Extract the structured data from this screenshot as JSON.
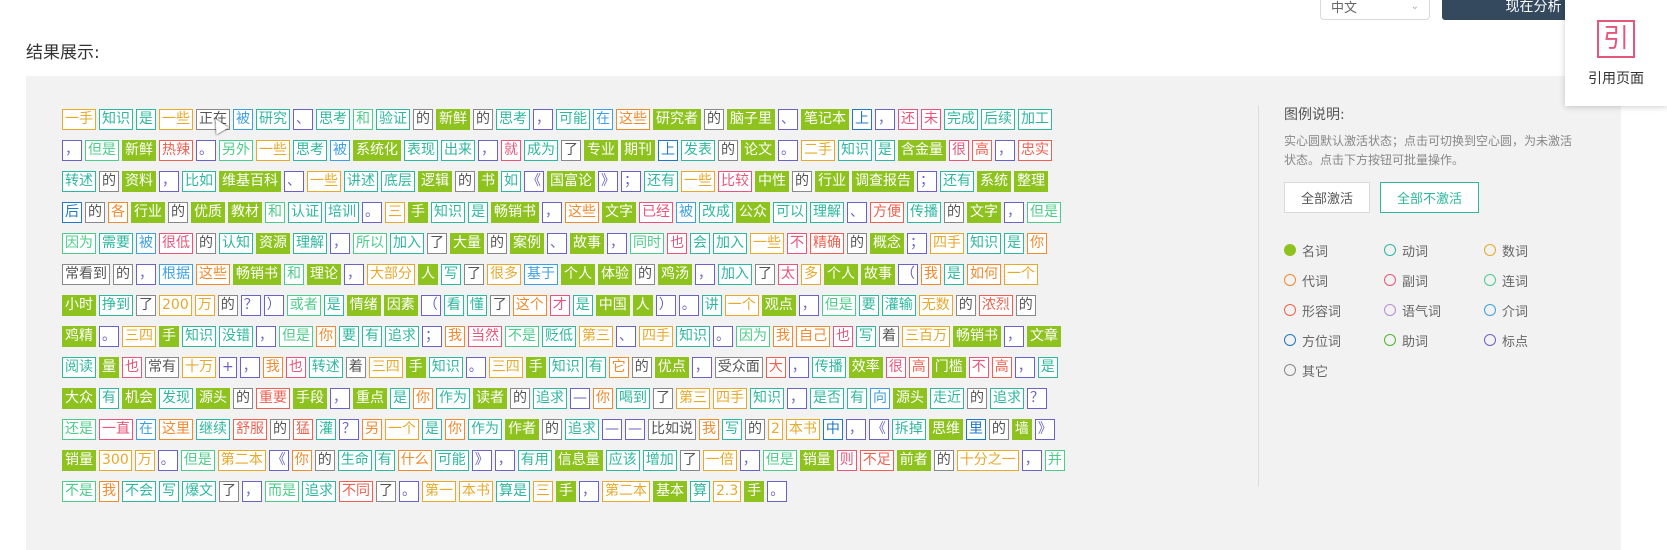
{
  "top_select": {
    "value": "中文"
  },
  "top_button": {
    "label": "现在分析"
  },
  "section_title": "结果展示:",
  "cite": {
    "icon": "引",
    "label": "引用页面"
  },
  "legend": {
    "title": "图例说明:",
    "desc": "实心圆默认激活状态；点击可切换到空心圆，为未激活状态。点击下方按钮可批量操作。",
    "btn_all_on": "全部激活",
    "btn_all_off": "全部不激活",
    "items": [
      {
        "label": "名词",
        "color": "#8ec31f",
        "filled": true
      },
      {
        "label": "动词",
        "color": "#2db7a0",
        "filled": false
      },
      {
        "label": "数词",
        "color": "#e8a92a",
        "filled": false
      },
      {
        "label": "代词",
        "color": "#f08a2e",
        "filled": false
      },
      {
        "label": "副词",
        "color": "#e8557a",
        "filled": false
      },
      {
        "label": "连词",
        "color": "#4ccc8a",
        "filled": false
      },
      {
        "label": "形容词",
        "color": "#f06050",
        "filled": false
      },
      {
        "label": "语气词",
        "color": "#b58cd6",
        "filled": false
      },
      {
        "label": "介词",
        "color": "#3da0e6",
        "filled": false
      },
      {
        "label": "方位词",
        "color": "#1f78c8",
        "filled": false
      },
      {
        "label": "助词",
        "color": "#52b52e",
        "filled": false
      },
      {
        "label": "标点",
        "color": "#6b62c8",
        "filled": false
      },
      {
        "label": "其它",
        "color": "#888888",
        "filled": false
      }
    ]
  },
  "lines": [
    [
      [
        "一手",
        "m"
      ],
      [
        "知识",
        "v"
      ],
      [
        "是",
        "v"
      ],
      [
        "一些",
        "m"
      ],
      [
        "正在",
        "x"
      ],
      [
        "被",
        "p"
      ],
      [
        "研究",
        "v"
      ],
      [
        "、",
        "w"
      ],
      [
        "思考",
        "v"
      ],
      [
        "和",
        "c"
      ],
      [
        "验证",
        "v"
      ],
      [
        "的",
        "x"
      ],
      [
        "新鲜",
        "n"
      ],
      [
        "的",
        "x"
      ],
      [
        "思考",
        "v"
      ],
      [
        "，",
        "w"
      ],
      [
        "可能",
        "v"
      ],
      [
        "在",
        "p"
      ],
      [
        "这些",
        "r"
      ],
      [
        "研究者",
        "n"
      ],
      [
        "的",
        "x"
      ],
      [
        "脑子里",
        "n"
      ],
      [
        "、",
        "w"
      ],
      [
        "笔记本",
        "n"
      ],
      [
        "上",
        "f"
      ],
      [
        "，",
        "w"
      ],
      [
        "还",
        "d"
      ],
      [
        "未",
        "d"
      ],
      [
        "完成",
        "v"
      ],
      [
        "后续",
        "v"
      ],
      [
        "加工",
        "v"
      ]
    ],
    [
      [
        "，",
        "w"
      ],
      [
        "但是",
        "c"
      ],
      [
        "新鲜",
        "n"
      ],
      [
        "热辣",
        "a"
      ],
      [
        "。",
        "w"
      ],
      [
        "另外",
        "c"
      ],
      [
        "一些",
        "m"
      ],
      [
        "思考",
        "v"
      ],
      [
        "被",
        "p"
      ],
      [
        "系统化",
        "n"
      ],
      [
        "表现",
        "v"
      ],
      [
        "出来",
        "v"
      ],
      [
        "，",
        "w"
      ],
      [
        "就",
        "d"
      ],
      [
        "成为",
        "v"
      ],
      [
        "了",
        "x"
      ],
      [
        "专业",
        "n"
      ],
      [
        "期刊",
        "n"
      ],
      [
        "上",
        "f"
      ],
      [
        "发表",
        "v"
      ],
      [
        "的",
        "x"
      ],
      [
        "论文",
        "n"
      ],
      [
        "。",
        "w"
      ],
      [
        "二手",
        "m"
      ],
      [
        "知识",
        "v"
      ],
      [
        "是",
        "v"
      ],
      [
        "含金量",
        "n"
      ],
      [
        "很",
        "d"
      ],
      [
        "高",
        "a"
      ],
      [
        "，",
        "w"
      ],
      [
        "忠实",
        "a"
      ]
    ],
    [
      [
        "转述",
        "v"
      ],
      [
        "的",
        "x"
      ],
      [
        "资料",
        "n"
      ],
      [
        "，",
        "w"
      ],
      [
        "比如",
        "v"
      ],
      [
        "维基百科",
        "n"
      ],
      [
        "、",
        "w"
      ],
      [
        "一些",
        "m"
      ],
      [
        "讲述",
        "v"
      ],
      [
        "底层",
        "v"
      ],
      [
        "逻辑",
        "n"
      ],
      [
        "的",
        "x"
      ],
      [
        "书",
        "n"
      ],
      [
        "如",
        "v"
      ],
      [
        "《",
        "w"
      ],
      [
        "国富论",
        "n"
      ],
      [
        "》",
        "w"
      ],
      [
        "；",
        "w"
      ],
      [
        "还有",
        "v"
      ],
      [
        "一些",
        "m"
      ],
      [
        "比较",
        "d"
      ],
      [
        "中性",
        "n"
      ],
      [
        "的",
        "x"
      ],
      [
        "行业",
        "n"
      ],
      [
        "调查报告",
        "n"
      ],
      [
        "；",
        "w"
      ],
      [
        "还有",
        "v"
      ],
      [
        "系统",
        "n"
      ],
      [
        "整理",
        "n"
      ]
    ],
    [
      [
        "后",
        "f"
      ],
      [
        "的",
        "x"
      ],
      [
        "各",
        "r"
      ],
      [
        "行业",
        "n"
      ],
      [
        "的",
        "x"
      ],
      [
        "优质",
        "n"
      ],
      [
        "教材",
        "n"
      ],
      [
        "和",
        "c"
      ],
      [
        "认证",
        "v"
      ],
      [
        "培训",
        "v"
      ],
      [
        "。",
        "w"
      ],
      [
        "三",
        "m"
      ],
      [
        "手",
        "n"
      ],
      [
        "知识",
        "v"
      ],
      [
        "是",
        "v"
      ],
      [
        "畅销书",
        "n"
      ],
      [
        "，",
        "w"
      ],
      [
        "这些",
        "r"
      ],
      [
        "文字",
        "n"
      ],
      [
        "已经",
        "d"
      ],
      [
        "被",
        "p"
      ],
      [
        "改成",
        "v"
      ],
      [
        "公众",
        "n"
      ],
      [
        "可以",
        "v"
      ],
      [
        "理解",
        "v"
      ],
      [
        "、",
        "w"
      ],
      [
        "方便",
        "a"
      ],
      [
        "传播",
        "v"
      ],
      [
        "的",
        "x"
      ],
      [
        "文字",
        "n"
      ],
      [
        "，",
        "w"
      ],
      [
        "但是",
        "c"
      ]
    ],
    [
      [
        "因为",
        "c"
      ],
      [
        "需要",
        "v"
      ],
      [
        "被",
        "p"
      ],
      [
        "很低",
        "d"
      ],
      [
        "的",
        "x"
      ],
      [
        "认知",
        "v"
      ],
      [
        "资源",
        "n"
      ],
      [
        "理解",
        "v"
      ],
      [
        "，",
        "w"
      ],
      [
        "所以",
        "c"
      ],
      [
        "加入",
        "v"
      ],
      [
        "了",
        "x"
      ],
      [
        "大量",
        "n"
      ],
      [
        "的",
        "x"
      ],
      [
        "案例",
        "n"
      ],
      [
        "、",
        "w"
      ],
      [
        "故事",
        "n"
      ],
      [
        "，",
        "w"
      ],
      [
        "同时",
        "c"
      ],
      [
        "也",
        "d"
      ],
      [
        "会",
        "v"
      ],
      [
        "加入",
        "v"
      ],
      [
        "一些",
        "m"
      ],
      [
        "不",
        "d"
      ],
      [
        "精确",
        "a"
      ],
      [
        "的",
        "x"
      ],
      [
        "概念",
        "n"
      ],
      [
        "；",
        "w"
      ],
      [
        "四手",
        "m"
      ],
      [
        "知识",
        "v"
      ],
      [
        "是",
        "v"
      ],
      [
        "你",
        "r"
      ]
    ],
    [
      [
        "常看到",
        "x"
      ],
      [
        "的",
        "x"
      ],
      [
        "，",
        "w"
      ],
      [
        "根据",
        "p"
      ],
      [
        "这些",
        "r"
      ],
      [
        "畅销书",
        "n"
      ],
      [
        "和",
        "c"
      ],
      [
        "理论",
        "n"
      ],
      [
        "，",
        "w"
      ],
      [
        "大部分",
        "m"
      ],
      [
        "人",
        "n"
      ],
      [
        "写",
        "v"
      ],
      [
        "了",
        "x"
      ],
      [
        "很多",
        "m"
      ],
      [
        "基于",
        "p"
      ],
      [
        "个人",
        "n"
      ],
      [
        "体验",
        "n"
      ],
      [
        "的",
        "x"
      ],
      [
        "鸡汤",
        "n"
      ],
      [
        "，",
        "w"
      ],
      [
        "加入",
        "v"
      ],
      [
        "了",
        "x"
      ],
      [
        "太",
        "d"
      ],
      [
        "多",
        "m"
      ],
      [
        "个人",
        "n"
      ],
      [
        "故事",
        "n"
      ],
      [
        "（",
        "w"
      ],
      [
        "我",
        "r"
      ],
      [
        "是",
        "v"
      ],
      [
        "如何",
        "r"
      ],
      [
        "一个",
        "m"
      ]
    ],
    [
      [
        "小时",
        "n"
      ],
      [
        "挣到",
        "v"
      ],
      [
        "了",
        "x"
      ],
      [
        "200",
        "m"
      ],
      [
        "万",
        "m"
      ],
      [
        "的",
        "x"
      ],
      [
        "？",
        "w"
      ],
      [
        "）",
        "w"
      ],
      [
        "或者",
        "c"
      ],
      [
        "是",
        "v"
      ],
      [
        "情绪",
        "n"
      ],
      [
        "因素",
        "n"
      ],
      [
        "（",
        "w"
      ],
      [
        "看",
        "v"
      ],
      [
        "懂",
        "v"
      ],
      [
        "了",
        "x"
      ],
      [
        "这个",
        "r"
      ],
      [
        "才",
        "d"
      ],
      [
        "是",
        "v"
      ],
      [
        "中国",
        "n"
      ],
      [
        "人",
        "n"
      ],
      [
        "）",
        "w"
      ],
      [
        "。",
        "w"
      ],
      [
        "讲",
        "v"
      ],
      [
        "一个",
        "m"
      ],
      [
        "观点",
        "n"
      ],
      [
        "，",
        "w"
      ],
      [
        "但是",
        "c"
      ],
      [
        "要",
        "v"
      ],
      [
        "灌输",
        "v"
      ],
      [
        "无数",
        "m"
      ],
      [
        "的",
        "x"
      ],
      [
        "浓烈",
        "a"
      ],
      [
        "的",
        "x"
      ]
    ],
    [
      [
        "鸡精",
        "n"
      ],
      [
        "。",
        "w"
      ],
      [
        "三四",
        "m"
      ],
      [
        "手",
        "n"
      ],
      [
        "知识",
        "v"
      ],
      [
        "没错",
        "v"
      ],
      [
        "，",
        "w"
      ],
      [
        "但是",
        "c"
      ],
      [
        "你",
        "r"
      ],
      [
        "要",
        "v"
      ],
      [
        "有",
        "v"
      ],
      [
        "追求",
        "v"
      ],
      [
        "；",
        "w"
      ],
      [
        "我",
        "r"
      ],
      [
        "当然",
        "d"
      ],
      [
        "不是",
        "c"
      ],
      [
        "贬低",
        "v"
      ],
      [
        "第三",
        "m"
      ],
      [
        "、",
        "w"
      ],
      [
        "四手",
        "m"
      ],
      [
        "知识",
        "v"
      ],
      [
        "。",
        "w"
      ],
      [
        "因为",
        "c"
      ],
      [
        "我",
        "r"
      ],
      [
        "自己",
        "r"
      ],
      [
        "也",
        "d"
      ],
      [
        "写",
        "v"
      ],
      [
        "着",
        "x"
      ],
      [
        "三百万",
        "m"
      ],
      [
        "畅销书",
        "n"
      ],
      [
        "，",
        "w"
      ],
      [
        "文章",
        "n"
      ]
    ],
    [
      [
        "阅读",
        "v"
      ],
      [
        "量",
        "n"
      ],
      [
        "也",
        "d"
      ],
      [
        "常有",
        "x"
      ],
      [
        "十万",
        "m"
      ],
      [
        "+",
        "w"
      ],
      [
        "，",
        "w"
      ],
      [
        "我",
        "r"
      ],
      [
        "也",
        "d"
      ],
      [
        "转述",
        "v"
      ],
      [
        "着",
        "x"
      ],
      [
        "三四",
        "m"
      ],
      [
        "手",
        "n"
      ],
      [
        "知识",
        "v"
      ],
      [
        "。",
        "w"
      ],
      [
        "三四",
        "m"
      ],
      [
        "手",
        "n"
      ],
      [
        "知识",
        "v"
      ],
      [
        "有",
        "v"
      ],
      [
        "它",
        "r"
      ],
      [
        "的",
        "x"
      ],
      [
        "优点",
        "n"
      ],
      [
        "，",
        "w"
      ],
      [
        "受众面",
        "x"
      ],
      [
        "大",
        "a"
      ],
      [
        "，",
        "w"
      ],
      [
        "传播",
        "v"
      ],
      [
        "效率",
        "n"
      ],
      [
        "很",
        "d"
      ],
      [
        "高",
        "a"
      ],
      [
        "门槛",
        "n"
      ],
      [
        "不",
        "d"
      ],
      [
        "高",
        "a"
      ],
      [
        "，",
        "w"
      ],
      [
        "是",
        "v"
      ]
    ],
    [
      [
        "大众",
        "n"
      ],
      [
        "有",
        "v"
      ],
      [
        "机会",
        "n"
      ],
      [
        "发现",
        "v"
      ],
      [
        "源头",
        "n"
      ],
      [
        "的",
        "x"
      ],
      [
        "重要",
        "a"
      ],
      [
        "手段",
        "n"
      ],
      [
        "，",
        "w"
      ],
      [
        "重点",
        "n"
      ],
      [
        "是",
        "v"
      ],
      [
        "你",
        "r"
      ],
      [
        "作为",
        "v"
      ],
      [
        "读者",
        "n"
      ],
      [
        "的",
        "x"
      ],
      [
        "追求",
        "v"
      ],
      [
        "—",
        "w"
      ],
      [
        "你",
        "r"
      ],
      [
        "喝到",
        "v"
      ],
      [
        "了",
        "x"
      ],
      [
        "第三",
        "m"
      ],
      [
        "四手",
        "m"
      ],
      [
        "知识",
        "v"
      ],
      [
        "，",
        "w"
      ],
      [
        "是否",
        "v"
      ],
      [
        "有",
        "v"
      ],
      [
        "向",
        "p"
      ],
      [
        "源头",
        "n"
      ],
      [
        "走近",
        "v"
      ],
      [
        "的",
        "x"
      ],
      [
        "追求",
        "v"
      ],
      [
        "？",
        "w"
      ]
    ],
    [
      [
        "还是",
        "c"
      ],
      [
        "一直",
        "d"
      ],
      [
        "在",
        "p"
      ],
      [
        "这里",
        "r"
      ],
      [
        "继续",
        "v"
      ],
      [
        "舒服",
        "a"
      ],
      [
        "的",
        "x"
      ],
      [
        "猛",
        "a"
      ],
      [
        "灌",
        "v"
      ],
      [
        "？",
        "w"
      ],
      [
        "另",
        "r"
      ],
      [
        "一个",
        "m"
      ],
      [
        "是",
        "v"
      ],
      [
        "你",
        "r"
      ],
      [
        "作为",
        "v"
      ],
      [
        "作者",
        "n"
      ],
      [
        "的",
        "x"
      ],
      [
        "追求",
        "v"
      ],
      [
        "—",
        "w"
      ],
      [
        "—",
        "w"
      ],
      [
        "比如说",
        "x"
      ],
      [
        "我",
        "r"
      ],
      [
        "写",
        "v"
      ],
      [
        "的",
        "x"
      ],
      [
        "2",
        "m"
      ],
      [
        "本书",
        "m"
      ],
      [
        "中",
        "f"
      ],
      [
        "，",
        "w"
      ],
      [
        "《",
        "w"
      ],
      [
        "拆掉",
        "v"
      ],
      [
        "思维",
        "n"
      ],
      [
        "里",
        "f"
      ],
      [
        "的",
        "x"
      ],
      [
        "墙",
        "n"
      ],
      [
        "》",
        "w"
      ]
    ],
    [
      [
        "销量",
        "n"
      ],
      [
        "300",
        "m"
      ],
      [
        "万",
        "m"
      ],
      [
        "。",
        "w"
      ],
      [
        "但是",
        "c"
      ],
      [
        "第二本",
        "m"
      ],
      [
        "《",
        "w"
      ],
      [
        "你",
        "r"
      ],
      [
        "的",
        "x"
      ],
      [
        "生命",
        "v"
      ],
      [
        "有",
        "v"
      ],
      [
        "什么",
        "r"
      ],
      [
        "可能",
        "v"
      ],
      [
        "》",
        "w"
      ],
      [
        "，",
        "w"
      ],
      [
        "有用",
        "v"
      ],
      [
        "信息量",
        "n"
      ],
      [
        "应该",
        "v"
      ],
      [
        "增加",
        "v"
      ],
      [
        "了",
        "x"
      ],
      [
        "一倍",
        "m"
      ],
      [
        "，",
        "w"
      ],
      [
        "但是",
        "c"
      ],
      [
        "销量",
        "n"
      ],
      [
        "则",
        "d"
      ],
      [
        "不足",
        "a"
      ],
      [
        "前者",
        "n"
      ],
      [
        "的",
        "x"
      ],
      [
        "十分之一",
        "m"
      ],
      [
        "，",
        "w"
      ],
      [
        "并",
        "c"
      ]
    ],
    [
      [
        "不是",
        "c"
      ],
      [
        "我",
        "r"
      ],
      [
        "不会",
        "v"
      ],
      [
        "写",
        "v"
      ],
      [
        "爆文",
        "v"
      ],
      [
        "了",
        "x"
      ],
      [
        "，",
        "w"
      ],
      [
        "而是",
        "c"
      ],
      [
        "追求",
        "v"
      ],
      [
        "不同",
        "a"
      ],
      [
        "了",
        "x"
      ],
      [
        "。",
        "w"
      ],
      [
        "第一",
        "m"
      ],
      [
        "本书",
        "m"
      ],
      [
        "算是",
        "v"
      ],
      [
        "三",
        "m"
      ],
      [
        "手",
        "n"
      ],
      [
        "，",
        "w"
      ],
      [
        "第二本",
        "m"
      ],
      [
        "基本",
        "n"
      ],
      [
        "算",
        "v"
      ],
      [
        "2.3",
        "m"
      ],
      [
        "手",
        "n"
      ],
      [
        "。",
        "w"
      ]
    ]
  ]
}
